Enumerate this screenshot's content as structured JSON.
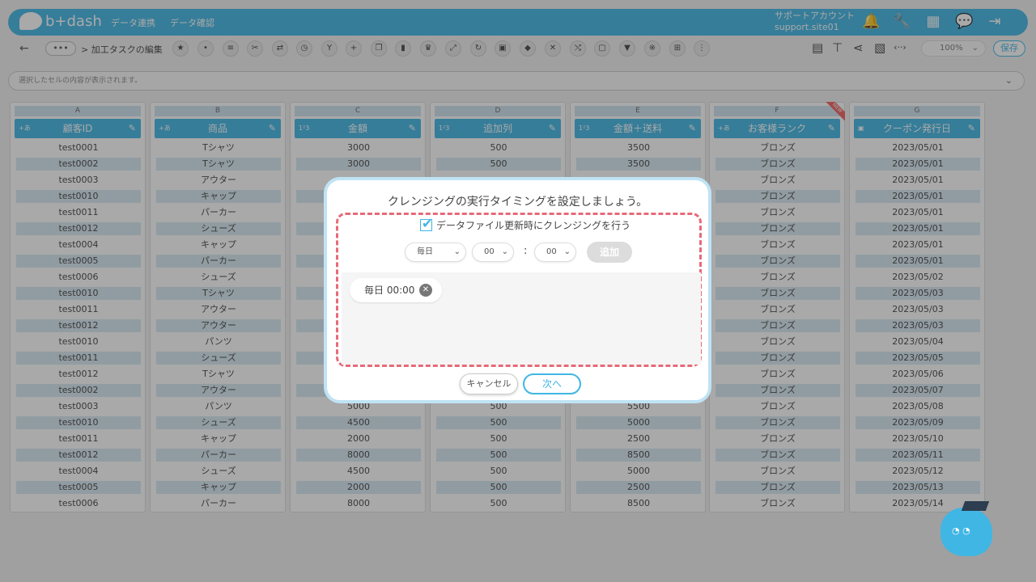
{
  "header": {
    "logo_text": "b+dash",
    "nav": [
      "データ連携",
      "データ確認"
    ],
    "account_name": "サポートアカウント",
    "account_site": "support.site01"
  },
  "toolbar": {
    "more": "•••",
    "breadcrumb": "> 加工タスクの編集",
    "zoom": "100%",
    "save_label": "保存"
  },
  "cellbar": {
    "placeholder": "選択したセルの内容が表示されます。"
  },
  "columns": [
    {
      "letter": "A",
      "type": "+あ",
      "name": "顧客ID",
      "is_new": false,
      "cells": [
        "test0001",
        "test0002",
        "test0003",
        "test0010",
        "test0011",
        "test0012",
        "test0004",
        "test0005",
        "test0006",
        "test0010",
        "test0011",
        "test0012",
        "test0010",
        "test0011",
        "test0012",
        "test0002",
        "test0003",
        "test0010",
        "test0011",
        "test0012",
        "test0004",
        "test0005",
        "test0006"
      ]
    },
    {
      "letter": "B",
      "type": "+あ",
      "name": "商品",
      "is_new": false,
      "cells": [
        "Tシャツ",
        "Tシャツ",
        "アウター",
        "キャップ",
        "パーカー",
        "シューズ",
        "キャップ",
        "パーカー",
        "シューズ",
        "Tシャツ",
        "アウター",
        "アウター",
        "パンツ",
        "シューズ",
        "Tシャツ",
        "アウター",
        "パンツ",
        "シューズ",
        "キャップ",
        "パーカー",
        "シューズ",
        "キャップ",
        "パーカー"
      ]
    },
    {
      "letter": "C",
      "type": "1²3",
      "name": "金額",
      "is_new": false,
      "cells": [
        "3000",
        "3000",
        "",
        "",
        "",
        "",
        "",
        "",
        "",
        "",
        "",
        "",
        "",
        "",
        "",
        "",
        "5000",
        "4500",
        "2000",
        "8000",
        "4500",
        "2000",
        "8000"
      ]
    },
    {
      "letter": "D",
      "type": "1²3",
      "name": "追加列",
      "is_new": false,
      "cells": [
        "500",
        "500",
        "",
        "",
        "",
        "",
        "",
        "",
        "",
        "",
        "",
        "",
        "",
        "",
        "",
        "",
        "500",
        "500",
        "500",
        "500",
        "500",
        "500",
        "500"
      ]
    },
    {
      "letter": "E",
      "type": "1²3",
      "name": "金額＋送料",
      "is_new": false,
      "cells": [
        "3500",
        "3500",
        "",
        "",
        "",
        "",
        "",
        "",
        "",
        "",
        "",
        "",
        "",
        "",
        "",
        "",
        "5500",
        "5000",
        "2500",
        "8500",
        "5000",
        "2500",
        "8500"
      ]
    },
    {
      "letter": "F",
      "type": "+あ",
      "name": "お客様ランク",
      "is_new": true,
      "new_label": "NEW",
      "cells": [
        "ブロンズ",
        "ブロンズ",
        "ブロンズ",
        "ブロンズ",
        "ブロンズ",
        "ブロンズ",
        "ブロンズ",
        "ブロンズ",
        "ブロンズ",
        "ブロンズ",
        "ブロンズ",
        "ブロンズ",
        "ブロンズ",
        "ブロンズ",
        "ブロンズ",
        "ブロンズ",
        "ブロンズ",
        "ブロンズ",
        "ブロンズ",
        "ブロンズ",
        "ブロンズ",
        "ブロンズ",
        "ブロンズ"
      ]
    },
    {
      "letter": "G",
      "type": "▣",
      "name": "クーポン発行日",
      "is_new": false,
      "cells": [
        "2023/05/01",
        "2023/05/01",
        "2023/05/01",
        "2023/05/01",
        "2023/05/01",
        "2023/05/01",
        "2023/05/01",
        "2023/05/01",
        "2023/05/02",
        "2023/05/03",
        "2023/05/03",
        "2023/05/03",
        "2023/05/04",
        "2023/05/05",
        "2023/05/06",
        "2023/05/07",
        "2023/05/08",
        "2023/05/09",
        "2023/05/10",
        "2023/05/11",
        "2023/05/12",
        "2023/05/13",
        "2023/05/14"
      ]
    }
  ],
  "modal": {
    "title": "クレンジングの実行タイミングを設定しましょう。",
    "checkbox_label": "データファイル更新時にクレンジングを行う",
    "checkbox_checked": true,
    "freq_value": "毎日",
    "hour_value": "00",
    "minute_value": "00",
    "colon": ":",
    "add_label": "追加",
    "schedules": [
      "毎日 00:00"
    ],
    "cancel_label": "キャンセル",
    "next_label": "次へ"
  },
  "colors": {
    "accent": "#40b6e4",
    "dash": "#e76a78"
  }
}
